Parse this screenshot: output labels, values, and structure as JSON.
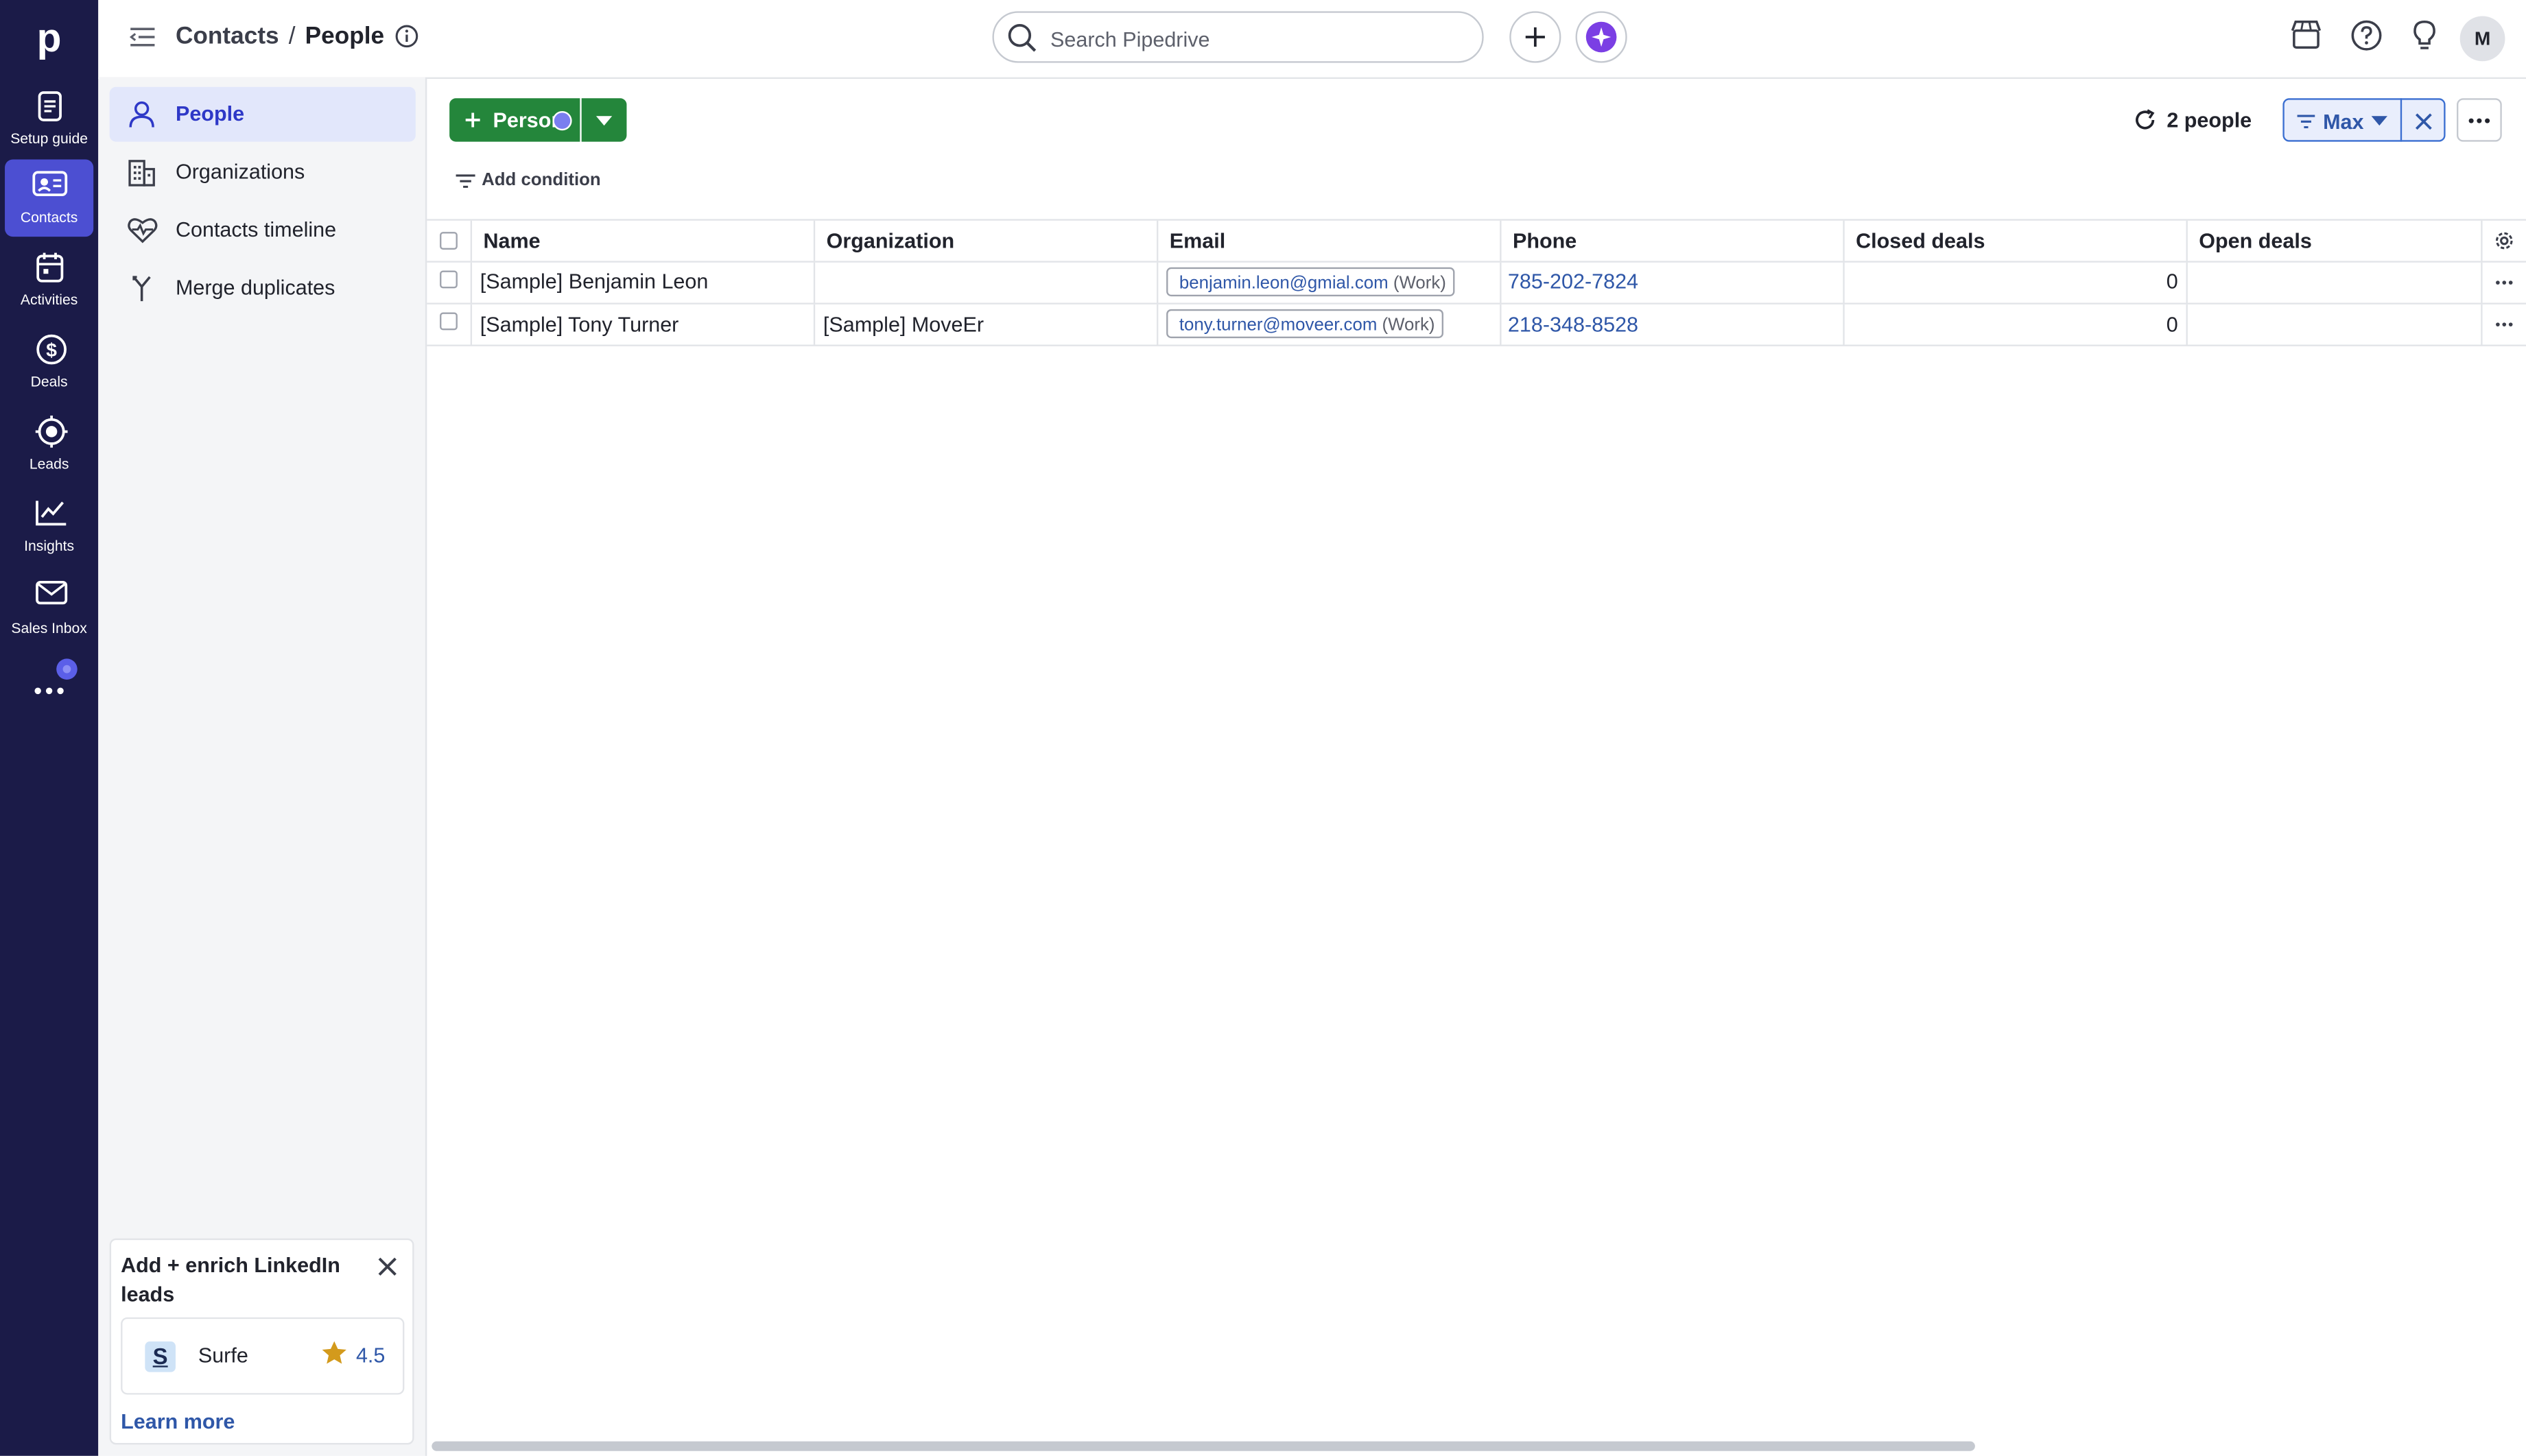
{
  "app": {
    "logo": "p"
  },
  "nav": {
    "items": [
      {
        "label": "Setup guide",
        "icon": "setup-guide-icon"
      },
      {
        "label": "Contacts",
        "icon": "contacts-icon",
        "active": true
      },
      {
        "label": "Activities",
        "icon": "calendar-icon"
      },
      {
        "label": "Deals",
        "icon": "dollar-icon"
      },
      {
        "label": "Leads",
        "icon": "target-icon"
      },
      {
        "label": "Insights",
        "icon": "chart-icon"
      },
      {
        "label": "Sales Inbox",
        "icon": "mail-icon"
      }
    ],
    "more_icon": "more-icon"
  },
  "header": {
    "breadcrumb_parent": "Contacts",
    "breadcrumb_separator": "/",
    "breadcrumb_current": "People",
    "search_placeholder": "Search Pipedrive",
    "avatar_initial": "M"
  },
  "sidepanel": {
    "items": [
      {
        "label": "People",
        "icon": "person-icon",
        "active": true
      },
      {
        "label": "Organizations",
        "icon": "building-icon"
      },
      {
        "label": "Contacts timeline",
        "icon": "heart-pulse-icon"
      },
      {
        "label": "Merge duplicates",
        "icon": "merge-icon"
      }
    ],
    "promo": {
      "title": "Add + enrich LinkedIn leads",
      "app_logo": "S",
      "app_name": "Surfe",
      "rating": "4.5",
      "learn_more": "Learn more"
    }
  },
  "toolbar": {
    "add_label": "Person",
    "add_condition": "Add condition",
    "count_label": "2 people",
    "filter_label": "Max"
  },
  "table": {
    "columns": [
      "Name",
      "Organization",
      "Email",
      "Phone",
      "Closed deals",
      "Open deals"
    ],
    "rows": [
      {
        "name": "[Sample] Benjamin Leon",
        "organization": "",
        "email": "benjamin.leon@gmial.com",
        "email_type": "(Work)",
        "phone": "785-202-7824",
        "closed_deals": "0",
        "open_deals": ""
      },
      {
        "name": "[Sample] Tony Turner",
        "organization": "[Sample] MoveEr",
        "email": "tony.turner@moveer.com",
        "email_type": "(Work)",
        "phone": "218-348-8528",
        "closed_deals": "0",
        "open_deals": ""
      }
    ]
  },
  "colors": {
    "rail": "#1b1b48",
    "rail_active": "#4c4fd2",
    "primary_green": "#24863b",
    "link": "#2f57a8",
    "panel_active": "#e2e7fb"
  }
}
